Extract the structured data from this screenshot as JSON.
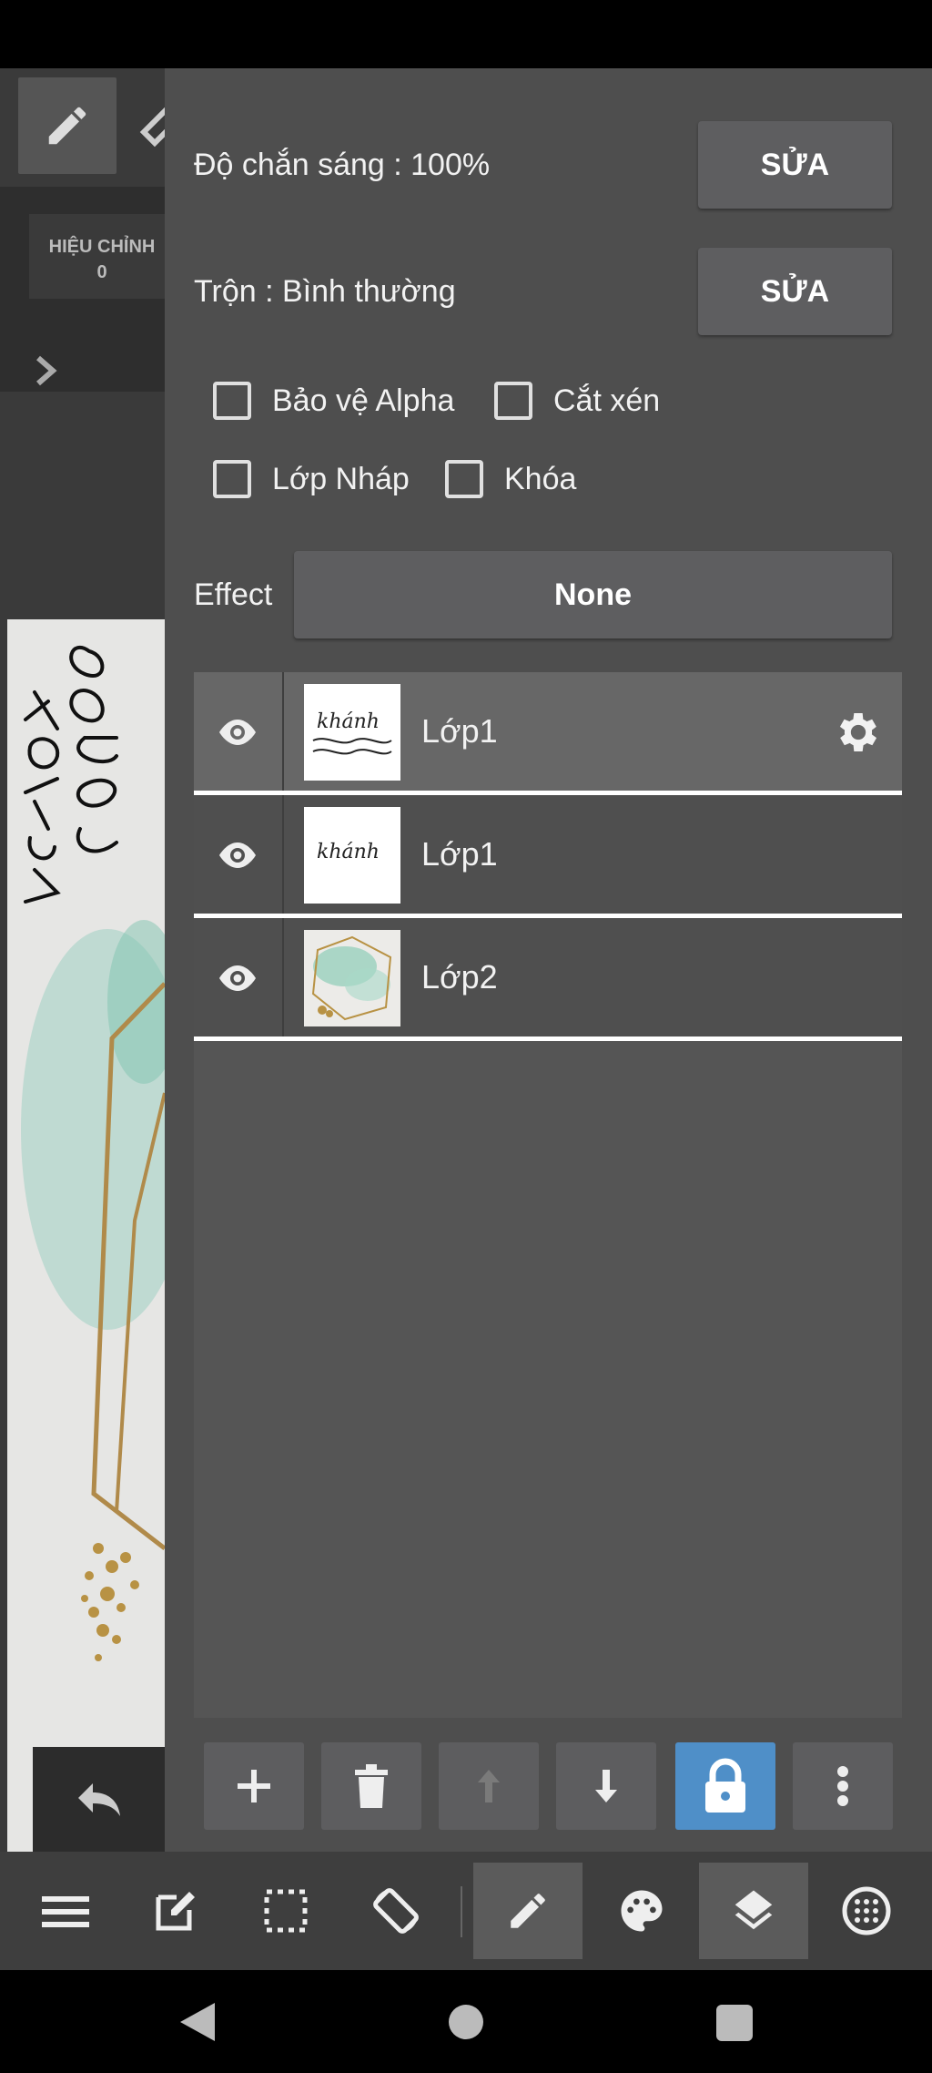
{
  "left_panel": {
    "adjust_label": "HIỆU CHỈNH",
    "adjust_value": "0"
  },
  "properties": {
    "opacity_label": "Độ chắn sáng : 100%",
    "opacity_edit": "SỬA",
    "blend_label": "Trộn : Bình thường",
    "blend_edit": "SỬA",
    "alpha_protect": "Bảo vệ Alpha",
    "clipping": "Cắt xén",
    "draft_layer": "Lớp Nháp",
    "lock": "Khóa",
    "effect_label": "Effect",
    "effect_value": "None"
  },
  "layers": [
    {
      "name": "Lớp1",
      "selected": true,
      "visible": true
    },
    {
      "name": "Lớp1",
      "selected": false,
      "visible": true
    },
    {
      "name": "Lớp2",
      "selected": false,
      "visible": true
    }
  ],
  "layer_toolbar": [
    "add-icon",
    "trash-icon",
    "arrow-up-icon",
    "arrow-down-icon",
    "lock-icon",
    "more-vertical-icon"
  ],
  "bottom_toolbar": [
    "menu-icon",
    "edit-icon",
    "selection-icon",
    "rotate-icon",
    "pen-icon",
    "palette-icon",
    "layers-icon",
    "material-icon"
  ],
  "colors": {
    "panel": "#4e4e4e",
    "button": "#5e5e60",
    "lock_active": "#4f8fc8",
    "bottom_bar": "#3e3e3e"
  }
}
